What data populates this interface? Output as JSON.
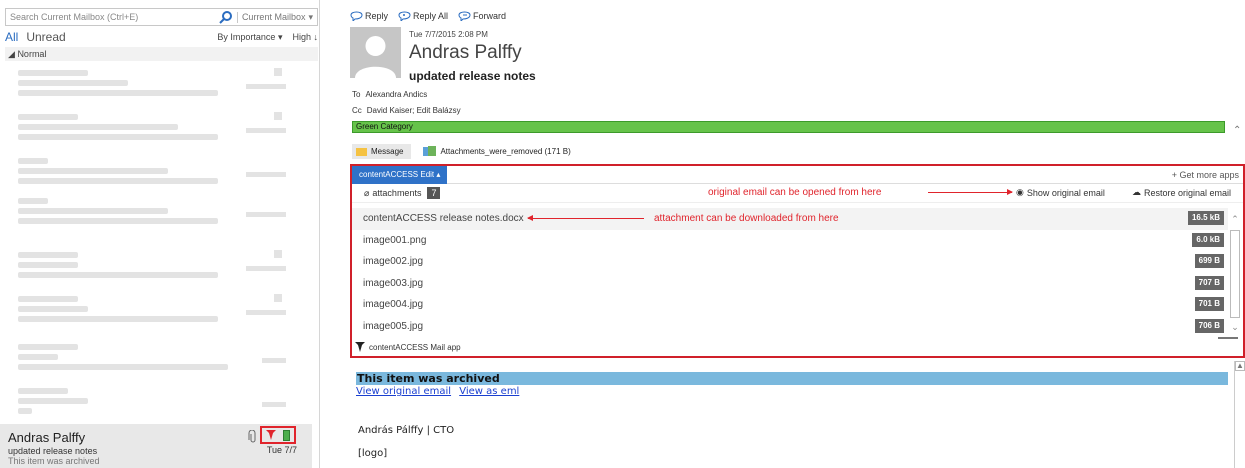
{
  "search": {
    "placeholder": "Search Current Mailbox (Ctrl+E)",
    "scope": "Current Mailbox"
  },
  "filters": {
    "all": "All",
    "unread": "Unread",
    "sort": "By Importance",
    "order": "High"
  },
  "group": {
    "label": "Normal"
  },
  "selected_mail": {
    "sender": "Andras Palffy",
    "subject": "updated release notes",
    "preview": "This item was archived",
    "date": "Tue 7/7"
  },
  "actions": {
    "reply": "Reply",
    "reply_all": "Reply All",
    "forward": "Forward"
  },
  "message": {
    "date": "Tue 7/7/2015 2:08 PM",
    "sender": "Andras Palffy",
    "subject": "updated release notes",
    "to_label": "To",
    "to": "Alexandra Andics",
    "cc_label": "Cc",
    "cc": "David Kaiser; Edit Balázsy",
    "category": "Green Category",
    "category_color": "#66c34a"
  },
  "tabs": {
    "message": "Message",
    "attachment": "Attachments_were_removed (171 B)"
  },
  "addin": {
    "title": "contentACCESS Edit",
    "more_apps": "Get more apps",
    "attachments_label": "attachments",
    "attachments_count": "7",
    "note_original": "original email can be opened from here",
    "show_original": "Show original email",
    "restore_original": "Restore original email",
    "note_attachment": "attachment can be downloaded from here",
    "files": [
      {
        "name": "contentACCESS release notes.docx",
        "size": "16.5 kB"
      },
      {
        "name": "image001.png",
        "size": "6.0 kB"
      },
      {
        "name": "image002.jpg",
        "size": "699 B"
      },
      {
        "name": "image003.jpg",
        "size": "707 B"
      },
      {
        "name": "image004.jpg",
        "size": "701 B"
      },
      {
        "name": "image005.jpg",
        "size": "706 B"
      }
    ],
    "footer": "contentACCESS Mail app",
    "accent_color": "#d0202a"
  },
  "body": {
    "archived": "This item was archived",
    "view_original": "View original email",
    "view_eml": "View as eml",
    "signature": "András Pálffy | CTO",
    "logo": "[logo]"
  }
}
